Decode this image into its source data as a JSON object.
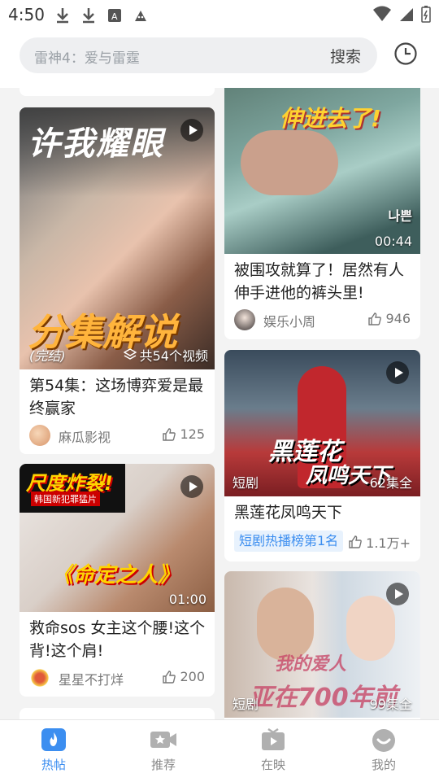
{
  "status": {
    "time": "4:50"
  },
  "search": {
    "placeholder": "雷神4：爱与雷霆",
    "button": "搜索"
  },
  "cards": [
    {
      "overlay_left": "(完结)",
      "overlay_right": "共54个视频",
      "big_text": "许我耀眼",
      "big_text2": "分集解说",
      "title": "第54集：这场博弈爱是最终赢家",
      "author": "麻瓜影视",
      "likes": "125"
    },
    {
      "overlay_left": "",
      "overlay_right": "00:44",
      "big_text": "伸进去了!",
      "title": "被围攻就算了！居然有人伸手进他的裤头里!",
      "author": "娱乐小周",
      "likes": "946"
    },
    {
      "overlay_left": "短剧",
      "overlay_right": "62集全",
      "big_text": "黑莲花",
      "big_text2": "凤鸣天下",
      "title": "黑莲花凤鸣天下",
      "tag": "短剧热播榜第1名",
      "likes": "1.1万+"
    },
    {
      "overlay_left": "",
      "overlay_right": "01:00",
      "big_text": "尺度炸裂!",
      "sub_text": "韩国新犯罪猛片",
      "big_text2": "《命定之人》",
      "title": "救命sos 女主这个腰!这个背!这个肩!",
      "author": "星星不打烊",
      "likes": "200"
    },
    {
      "overlay_left": "短剧",
      "overlay_right": "99集全",
      "big_text": "我的爱人",
      "big_text2": "亚在700年前"
    }
  ],
  "nav": [
    {
      "label": "热帖",
      "icon": "flame-icon",
      "active": true
    },
    {
      "label": "推荐",
      "icon": "video-camera-icon",
      "active": false
    },
    {
      "label": "在映",
      "icon": "tv-icon",
      "active": false
    },
    {
      "label": "我的",
      "icon": "smile-face-icon",
      "active": false
    }
  ],
  "colors": {
    "accent": "#3c8ef0"
  }
}
